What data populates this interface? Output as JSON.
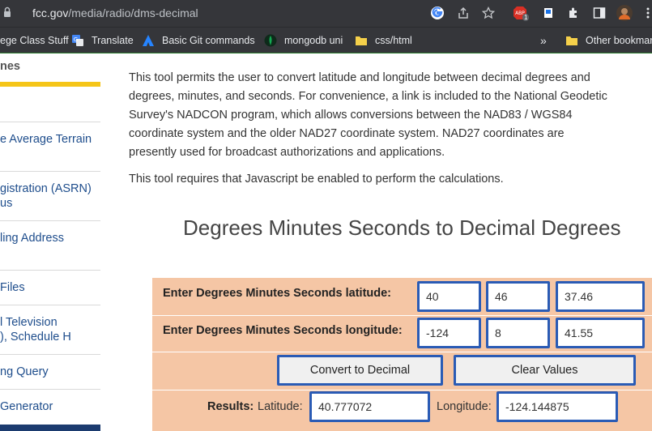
{
  "browser": {
    "url_host": "fcc.gov",
    "url_path": "/media/radio/dms-decimal",
    "extension_badge": "1"
  },
  "bookmarks": [
    {
      "label": "ege Class Stuff",
      "icon": "folder-icon"
    },
    {
      "label": "Translate",
      "icon": "translate-icon"
    },
    {
      "label": "Basic Git commands",
      "icon": "atlassian-icon"
    },
    {
      "label": "mongodb uni",
      "icon": "mongodb-icon"
    },
    {
      "label": "css/html",
      "icon": "folder-icon"
    },
    {
      "label": "Other bookmar",
      "icon": "folder-icon"
    }
  ],
  "sidebar": {
    "title": "nes",
    "items": [
      {
        "line1": "e Average Terrain",
        "line2": ""
      },
      {
        "line1": "gistration (ASRN)",
        "line2": "us"
      },
      {
        "line1": "ling Address",
        "line2": ""
      },
      {
        "line1": " Files",
        "line2": ""
      },
      {
        "line1": "l Television",
        "line2": "), Schedule H"
      },
      {
        "line1": "ng Query",
        "line2": ""
      },
      {
        "line1": "Generator",
        "line2": ""
      }
    ]
  },
  "content": {
    "intro": "This tool permits the user to convert latitude and longitude between decimal degrees and degrees, minutes, and seconds.  For convenience, a link is included to the National Geodetic Survey's NADCON program, which allows conversions between the NAD83 / WGS84 coordinate system and the older NAD27 coordinate system.  NAD27 coordinates are presently used for broadcast authorizations and applications.",
    "js_note": "This tool requires that Javascript be enabled to perform the calculations.",
    "heading": "Degrees Minutes Seconds to Decimal Degrees"
  },
  "form": {
    "lat_label": "Enter Degrees Minutes Seconds latitude:",
    "lat_deg": "40",
    "lat_min": "46",
    "lat_sec": "37.46",
    "lon_label": "Enter Degrees Minutes Seconds longitude:",
    "lon_deg": "-124",
    "lon_min": "8",
    "lon_sec": "41.55",
    "convert_button": "Convert to Decimal",
    "clear_button": "Clear Values",
    "results_label": "Results:",
    "latitude_label": "Latitude:",
    "latitude_value": "40.777072",
    "longitude_label": "Longitude:",
    "longitude_value": "-124.144875"
  }
}
